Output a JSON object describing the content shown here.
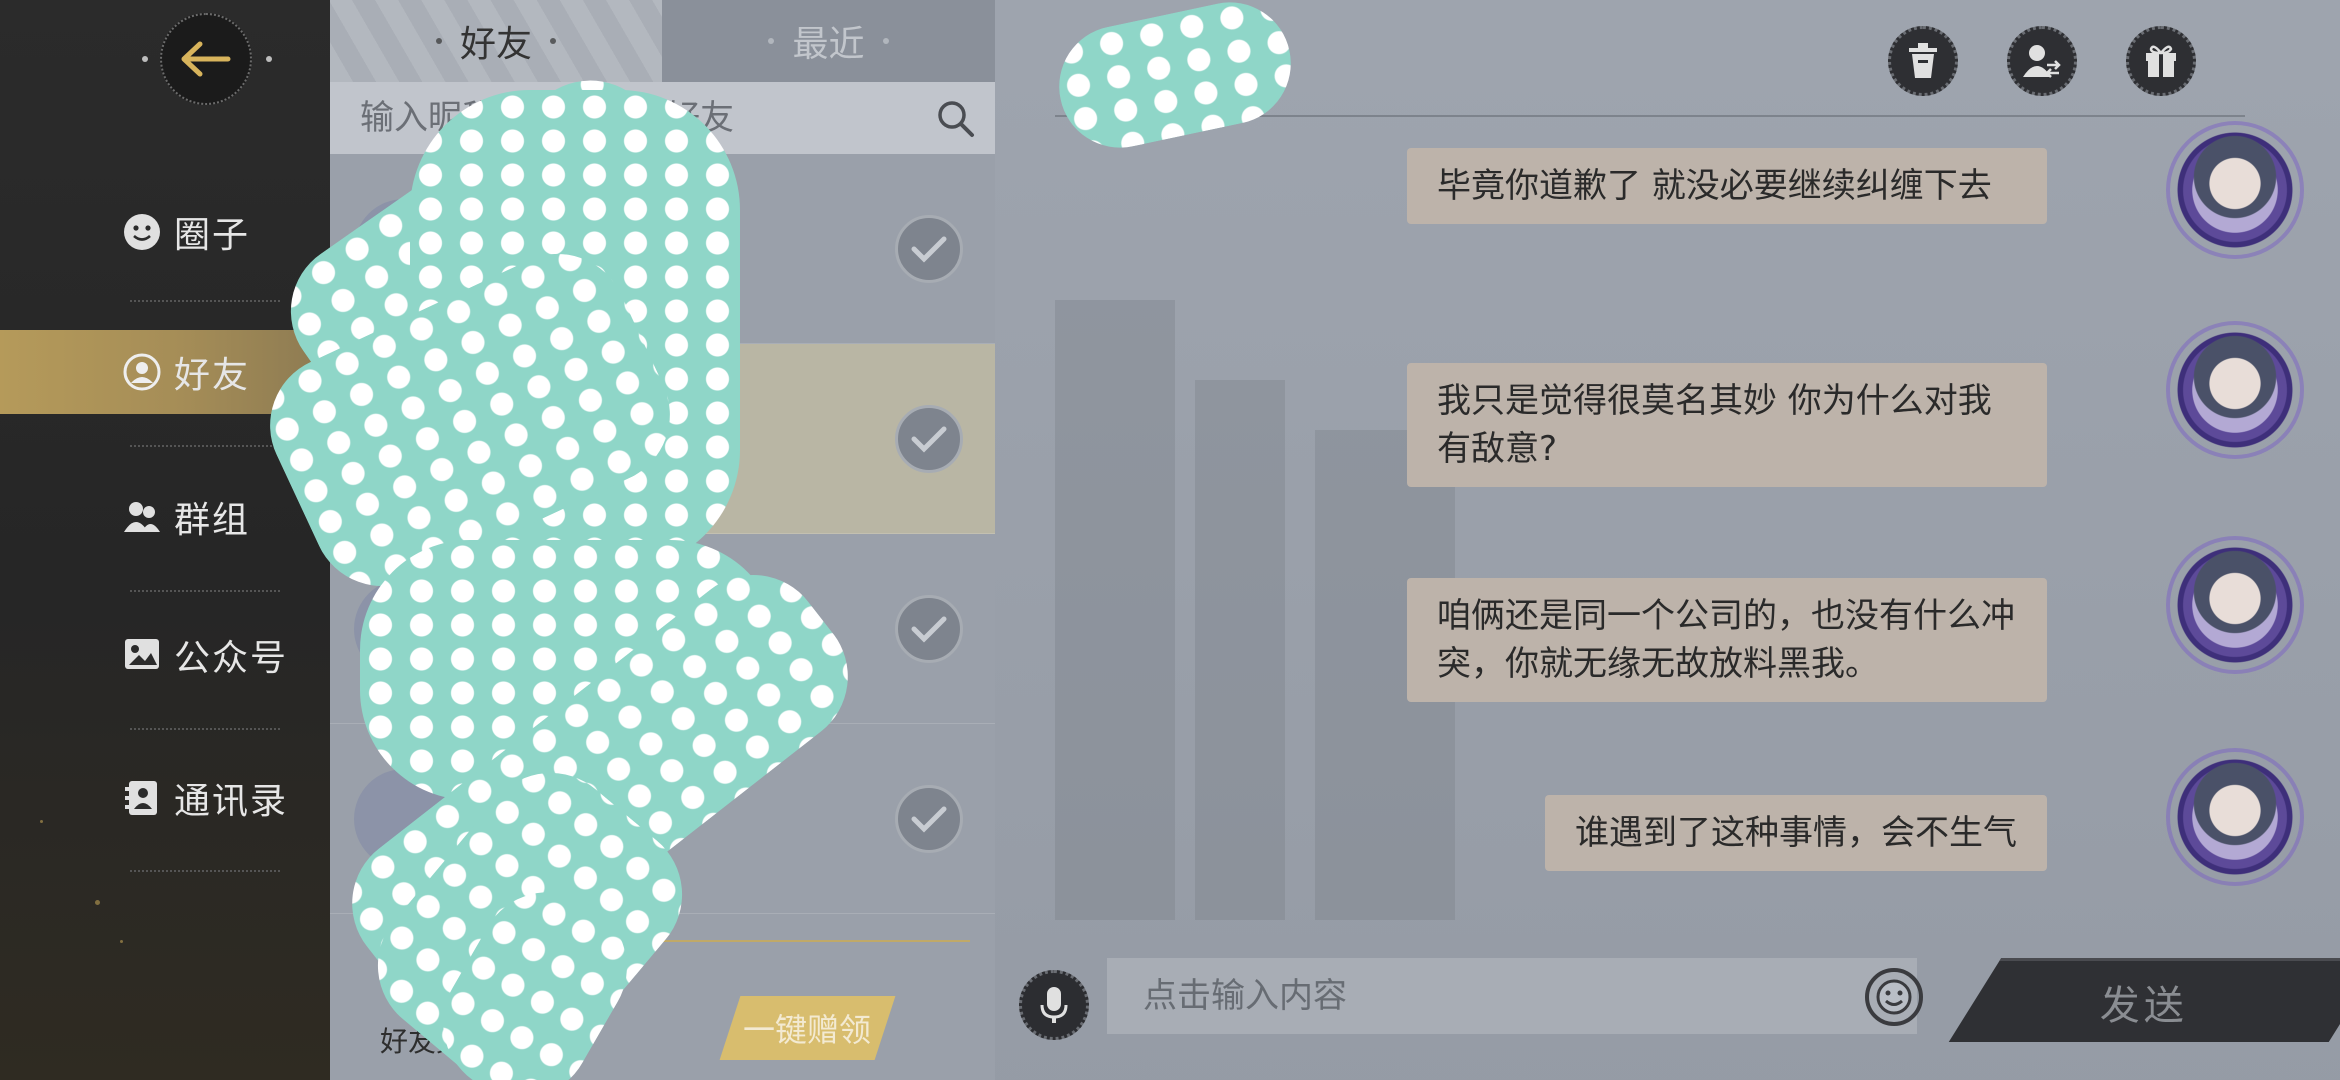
{
  "sidebar": {
    "items": [
      {
        "label": "圈子",
        "icon": "smiley-icon"
      },
      {
        "label": "好友",
        "icon": "friend-avatar-icon"
      },
      {
        "label": "群组",
        "icon": "group-icon"
      },
      {
        "label": "公众号",
        "icon": "picture-icon"
      },
      {
        "label": "通讯录",
        "icon": "contacts-book-icon"
      }
    ],
    "active_index": 1
  },
  "tabs": {
    "friends": "好友",
    "recent": "最近",
    "active": "friends"
  },
  "search": {
    "placeholder": "输入昵称或备注搜索好友"
  },
  "footer": {
    "friend_count_label": "好友数量",
    "gift_all_label": "一键赠领"
  },
  "chat": {
    "header_buttons": [
      "trash-icon",
      "switch-user-icon",
      "gift-icon"
    ],
    "messages": [
      {
        "text": "毕竟你道歉了 就没必要继续纠缠下去",
        "sender": "self"
      },
      {
        "text": "我只是觉得很莫名其妙 你为什么对我有敌意?",
        "sender": "self"
      },
      {
        "text": "咱俩还是同一个公司的，也没有什么冲突，你就无缘无故放料黑我。",
        "sender": "self"
      },
      {
        "text": "谁遇到了这种事情，会不生气",
        "sender": "self"
      }
    ],
    "input_placeholder": "点击输入内容",
    "send_label": "发送"
  },
  "colors": {
    "accent_gold": "#b59a5a",
    "bubble": "#bdb3aa",
    "overlay_teal": "#8fd6c8"
  }
}
